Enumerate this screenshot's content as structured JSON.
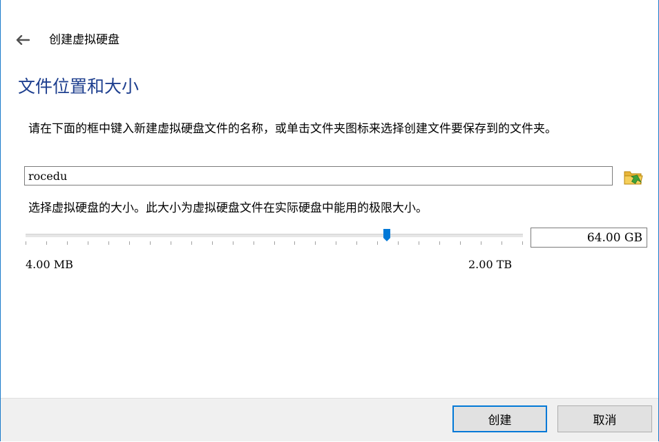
{
  "header": {
    "title": "创建虚拟硬盘",
    "back_icon": "back-arrow-icon"
  },
  "page_title": "文件位置和大小",
  "location": {
    "description": "请在下面的框中键入新建虚拟硬盘文件的名称，或单击文件夹图标来选择创建文件要保存到的文件夹。",
    "file_name": "rocedu",
    "folder_icon": "folder-icon"
  },
  "size": {
    "description": "选择虚拟硬盘的大小。此大小为虚拟硬盘文件在实际硬盘中能用的极限大小。",
    "value": "64.00 GB",
    "slider_min_label": "4.00 MB",
    "slider_max_label": "2.00 TB",
    "slider_position_fraction": 0.726
  },
  "buttons": {
    "create_label": "创建",
    "cancel_label": "取消"
  },
  "colors": {
    "accent": "#0078d7",
    "title": "#1e3f8f",
    "window_border": "#1979ca"
  }
}
